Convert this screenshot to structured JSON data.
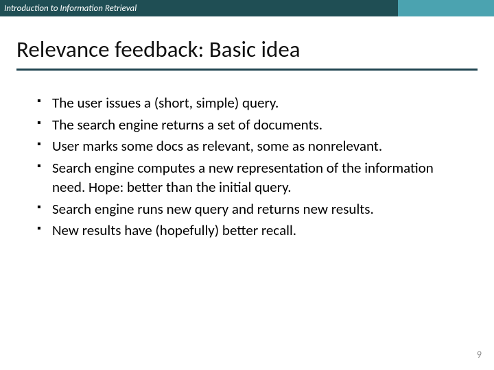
{
  "header": {
    "course": "Introduction to Information Retrieval"
  },
  "title": "Relevance feedback: Basic idea",
  "bullets": [
    "The user issues a (short, simple) query.",
    "The search engine returns a set of documents.",
    "User marks some docs as relevant, some as nonrelevant.",
    "Search engine computes a new representation of the information need. Hope: better than the initial query.",
    "Search engine runs new query and returns new results.",
    "New results have (hopefully) better recall."
  ],
  "page_number": "9"
}
